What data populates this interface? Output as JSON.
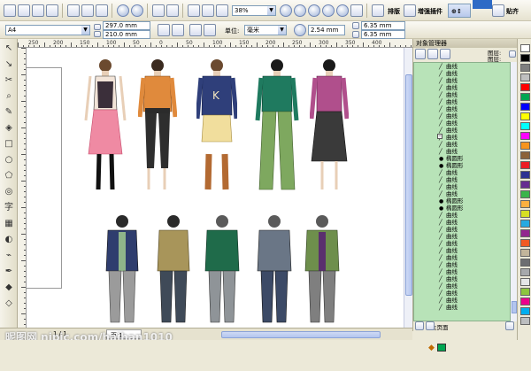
{
  "toolbar": {
    "zoom_value": "38%",
    "layout_label": "排版",
    "enhance_plugin_label": "增强插件",
    "paste_label": "贴齐"
  },
  "property_bar": {
    "page_size": "A4",
    "width": "297.0 mm",
    "height": "210.0 mm",
    "units_label": "单位:",
    "units_value": "毫米",
    "nudge": "2.54 mm",
    "dup_x": "6.35 mm",
    "dup_y": "6.35 mm"
  },
  "ruler": {
    "h_ticks": [
      "250",
      "200",
      "150",
      "100",
      "50",
      "0",
      "50",
      "100",
      "150",
      "200",
      "250",
      "300",
      "350",
      "400"
    ]
  },
  "docker": {
    "title": "对象管理器",
    "layer_a": "图层:",
    "layer_b": "图层:",
    "items": [
      "曲线",
      "曲线",
      "曲线",
      "曲线",
      "曲线",
      "曲线",
      "曲线",
      "曲线",
      "曲线",
      "曲线",
      "曲线",
      "曲线",
      "曲线",
      "椭圆形",
      "椭圆形",
      "曲线",
      "曲线",
      "曲线",
      "曲线",
      "椭圆形",
      "椭圆形",
      "曲线",
      "曲线",
      "曲线",
      "曲线",
      "曲线",
      "曲线",
      "曲线",
      "曲线",
      "曲线",
      "曲线",
      "曲线",
      "曲线",
      "曲线",
      "曲线"
    ],
    "footer_text": "主页面"
  },
  "status": {
    "page_info": "1 / 1",
    "page_tab": "页 1"
  },
  "watermark": "昵图网 nipic.com/haihan1010",
  "palette_colors": [
    "#ffffff",
    "#000000",
    "#7f7f7f",
    "#c0c0c0",
    "#ff0000",
    "#00a651",
    "#0000ff",
    "#ffff00",
    "#00ffff",
    "#ff00ff",
    "#f7941d",
    "#8c6239",
    "#ed1c24",
    "#2e3192",
    "#662d91",
    "#39b54a",
    "#fbb040",
    "#d7df23",
    "#27aae1",
    "#92278f",
    "#f15a24",
    "#c2b59b",
    "#6d6e71",
    "#a7a9ac",
    "#e6e7e8",
    "#8dc63f",
    "#ec008c",
    "#00aeef",
    "#bcbec0"
  ],
  "icons": {
    "toolbox": [
      "pick-tool-icon",
      "shape-tool-icon",
      "crop-tool-icon",
      "zoom-tool-icon",
      "freehand-tool-icon",
      "smart-fill-icon",
      "rectangle-tool-icon",
      "ellipse-tool-icon",
      "polygon-tool-icon",
      "spiral-tool-icon",
      "text-tool-icon",
      "table-tool-icon",
      "blend-tool-icon",
      "eyedropper-icon",
      "outline-pen-icon",
      "fill-tool-icon",
      "interactive-fill-icon"
    ]
  }
}
